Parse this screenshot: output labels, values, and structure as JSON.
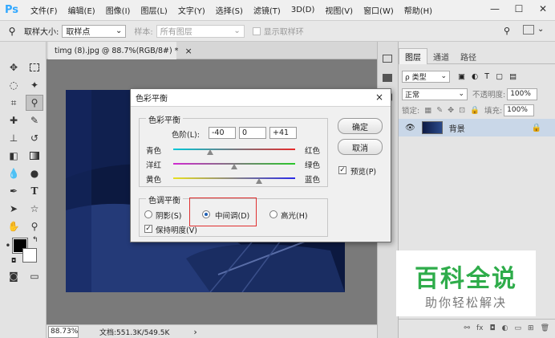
{
  "menubar": {
    "logo": "Ps",
    "items": [
      "文件(F)",
      "编辑(E)",
      "图像(I)",
      "图层(L)",
      "文字(Y)",
      "选择(S)",
      "滤镜(T)",
      "3D(D)",
      "视图(V)",
      "窗口(W)",
      "帮助(H)"
    ],
    "minimize": "—",
    "restore": "☐",
    "close": "✕"
  },
  "optionsbar": {
    "sample_size_label": "取样大小:",
    "sample_size_value": "取样点",
    "sample_label": "样本:",
    "sample_value": "所有图层",
    "show_ring_label": "显示取样环"
  },
  "document": {
    "tab_title": "timg (8).jpg @ 88.7%(RGB/8#) *",
    "tab_close": "×",
    "zoom": "88.73%",
    "doc_info": "文档:551.3K/549.5K",
    "status_arrow": "›"
  },
  "layers_panel": {
    "tabs": [
      "图层",
      "通道",
      "路径"
    ],
    "filter_kind": "ρ 类型",
    "blend_mode": "正常",
    "opacity_label": "不透明度:",
    "opacity_value": "100%",
    "lock_label": "锁定:",
    "fill_label": "填充:",
    "fill_value": "100%",
    "layer_name": "背景"
  },
  "dialog": {
    "title": "色彩平衡",
    "close": "×",
    "color_balance_group": "色彩平衡",
    "levels_label": "色阶(L):",
    "levels": [
      "-40",
      "0",
      "+41"
    ],
    "sliders": [
      {
        "left": "青色",
        "right": "红色",
        "value": -40,
        "left_color": "#00c8d8",
        "right_color": "#e82a2a"
      },
      {
        "left": "洋红",
        "right": "绿色",
        "value": 0,
        "left_color": "#d02ad0",
        "right_color": "#2ac82a"
      },
      {
        "left": "黄色",
        "right": "蓝色",
        "value": 41,
        "left_color": "#e8e020",
        "right_color": "#2a2ae8"
      }
    ],
    "tone_group": "色调平衡",
    "tone_options": [
      "阴影(S)",
      "中间调(D)",
      "高光(H)"
    ],
    "tone_selected": "中间调(D)",
    "preserve_label": "保持明度(V)",
    "preserve_checked": true,
    "ok": "确定",
    "cancel": "取消",
    "preview_label": "预览(P)",
    "preview_checked": true,
    "highlight_color": "#e03030"
  },
  "watermark": {
    "title": "百科全说",
    "subtitle": "助你轻松解决",
    "title_color": "#2eac4a",
    "subtitle_color": "#777777"
  }
}
